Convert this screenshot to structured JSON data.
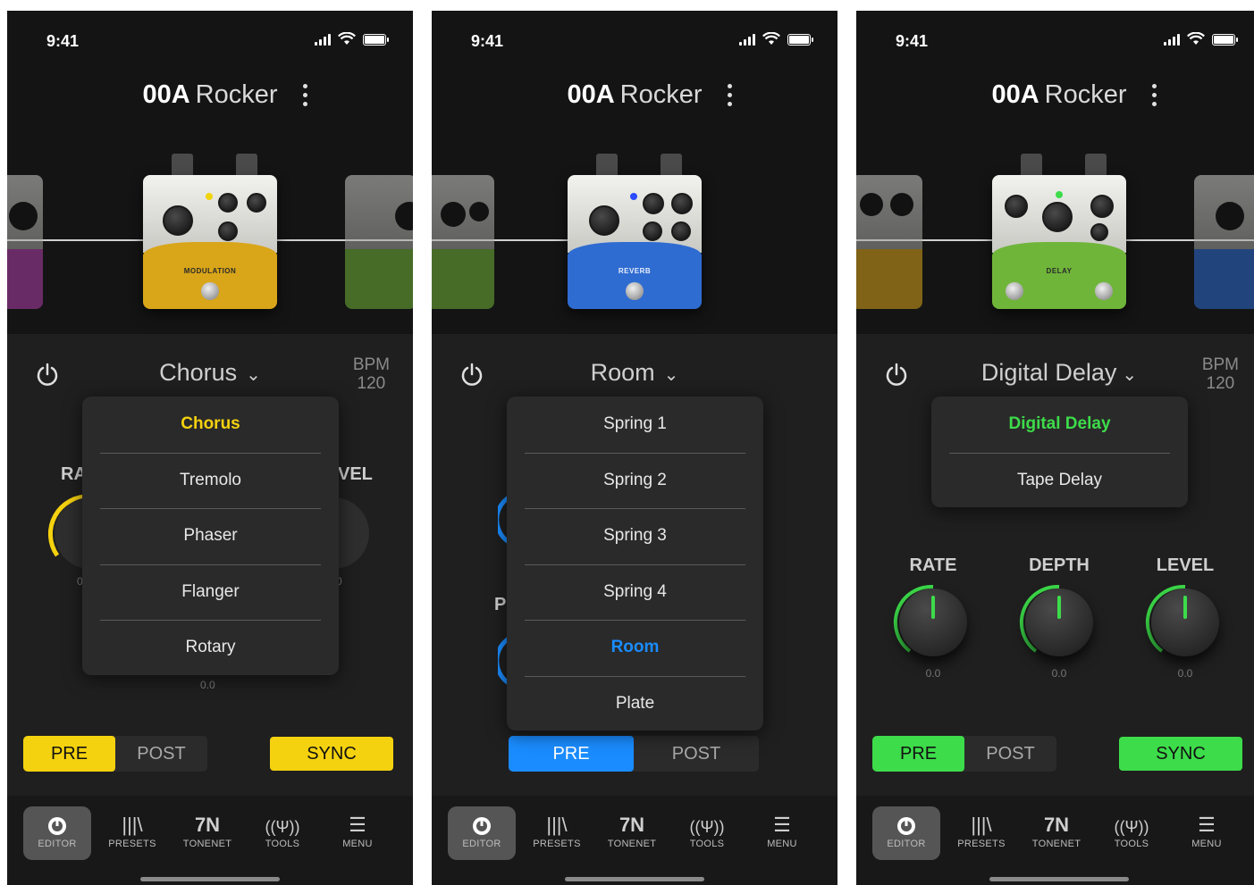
{
  "screens": [
    {
      "time": "9:41",
      "preset_code": "00A",
      "preset_name": "Rocker",
      "pedal_label": "MODULATION",
      "effect": "Chorus",
      "bpm_label": "BPM",
      "bpm_value": "120",
      "accent": "#f5d20f",
      "dropdown": [
        "Chorus",
        "Tremolo",
        "Phaser",
        "Flanger",
        "Rotary"
      ],
      "dropdown_selected": "Chorus",
      "partial_left_label": "RA",
      "partial_right_label": "VEL",
      "partial_left_value": "0",
      "partial_right_value": "0",
      "bottom_value": "0.0",
      "pre": "PRE",
      "post": "POST",
      "sync": "SYNC",
      "pre_active": true
    },
    {
      "time": "9:41",
      "preset_code": "00A",
      "preset_name": "Rocker",
      "pedal_label": "REVERB",
      "effect": "Room",
      "bpm_label": "",
      "bpm_value": "",
      "accent": "#1a8cff",
      "dropdown": [
        "Spring 1",
        "Spring 2",
        "Spring 3",
        "Spring 4",
        "Room",
        "Plate"
      ],
      "dropdown_selected": "Room",
      "partial_left_label": "P",
      "pre": "PRE",
      "post": "POST",
      "pre_active": true
    },
    {
      "time": "9:41",
      "preset_code": "00A",
      "preset_name": "Rocker",
      "pedal_label": "DELAY",
      "effect": "Digital Delay",
      "bpm_label": "BPM",
      "bpm_value": "120",
      "accent": "#3ddc4a",
      "dropdown": [
        "Digital Delay",
        "Tape Delay"
      ],
      "dropdown_selected": "Digital Delay",
      "knobs": [
        {
          "label": "RATE",
          "value": "0.0"
        },
        {
          "label": "DEPTH",
          "value": "0.0"
        },
        {
          "label": "LEVEL",
          "value": "0.0"
        }
      ],
      "pre": "PRE",
      "post": "POST",
      "sync": "SYNC",
      "pre_active": true
    }
  ],
  "tabs": [
    {
      "label": "EDITOR",
      "icon": "editor-icon",
      "active": true
    },
    {
      "label": "PRESETS",
      "icon": "presets-icon"
    },
    {
      "label": "TONENET",
      "icon": "tonenet-icon"
    },
    {
      "label": "TOOLS",
      "icon": "tools-icon"
    },
    {
      "label": "MENU",
      "icon": "menu-icon"
    }
  ]
}
